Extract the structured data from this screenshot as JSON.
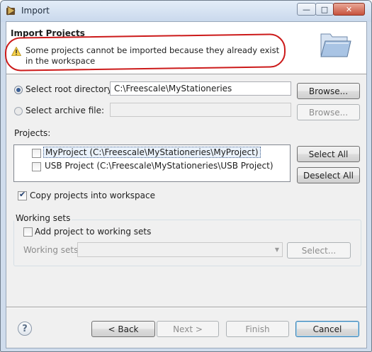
{
  "window": {
    "title": "Import"
  },
  "header": {
    "title": "Import Projects",
    "message": "Some projects cannot be imported because they already exist in the workspace",
    "warning_icon": "warning-icon",
    "banner_icon": "folder-icon"
  },
  "source": {
    "root_label": "Select root directory:",
    "root_value": "C:\\Freescale\\MyStationeries",
    "archive_label": "Select archive file:",
    "archive_value": "",
    "browse_label": "Browse...",
    "browse_archive_label": "Browse..."
  },
  "projects": {
    "label": "Projects:",
    "items": [
      {
        "label": "MyProject (C:\\Freescale\\MyStationeries\\MyProject)",
        "checked": false
      },
      {
        "label": "USB Project (C:\\Freescale\\MyStationeries\\USB Project)",
        "checked": false
      }
    ],
    "select_all": "Select All",
    "deselect_all": "Deselect All"
  },
  "copy_option": {
    "label": "Copy projects into workspace",
    "checked": true
  },
  "working_sets": {
    "title": "Working sets",
    "add_label": "Add project to working sets",
    "sets_label": "Working sets:",
    "combo_value": "",
    "select_label": "Select..."
  },
  "footer": {
    "help_glyph": "?",
    "back": "< Back",
    "next": "Next >",
    "finish": "Finish",
    "cancel": "Cancel"
  },
  "colors": {
    "annotation": "#cc1a1a",
    "window_frame": "#cfdcec",
    "close_button": "#c7523d"
  }
}
